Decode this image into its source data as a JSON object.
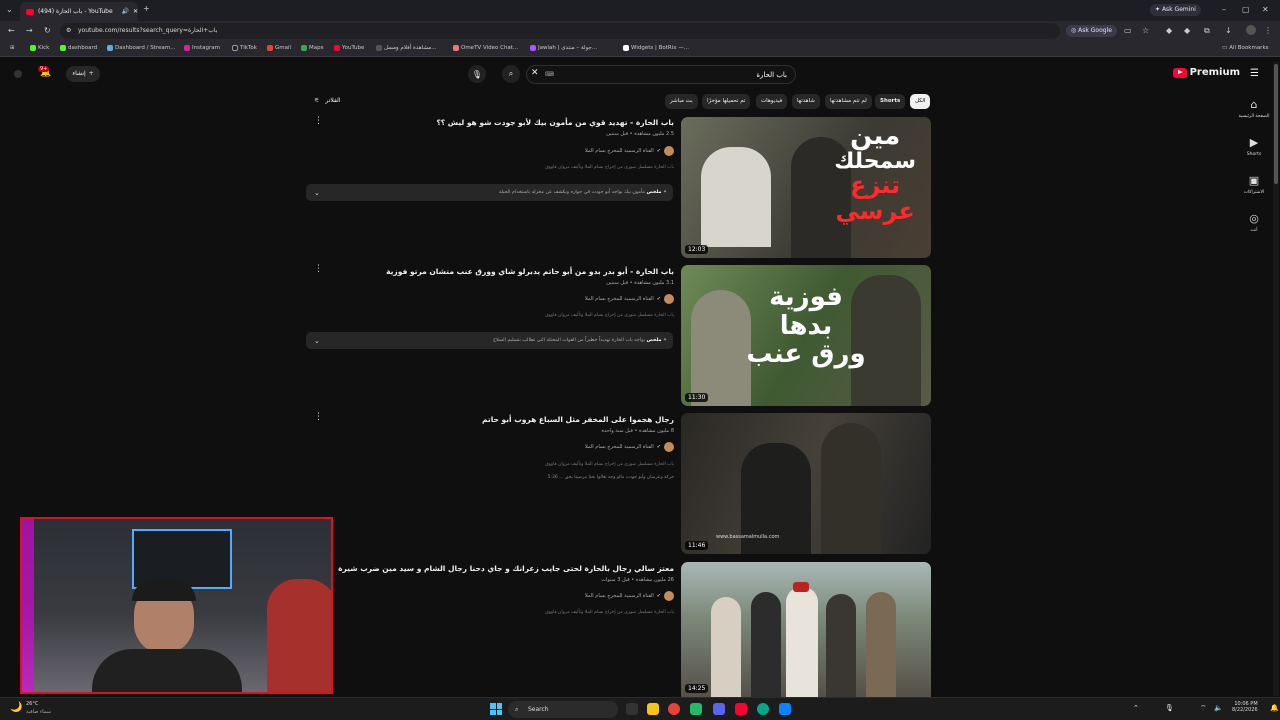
{
  "browser": {
    "tab_title": "(494) باب الحارة - YouTube",
    "url": "youtube.com/results?search_query=باب+الحارة",
    "ask_google": "Ask Google",
    "ask_gemini": "Ask Gemini",
    "all_bookmarks": "All Bookmarks",
    "bookmarks": [
      "Kick",
      "dashboard",
      "Dashboard / Stream...",
      "Instagram",
      "TikTok",
      "Gmail",
      "Maps",
      "YouTube",
      "مشاهدة أفلام ومسل...",
      "OmeTV Video Chat...",
      "Jawlah | جولة – منتدى...",
      "Widgets | BotRix —..."
    ]
  },
  "youtube": {
    "logo_text": "Premium",
    "search_value": "باب الحارة",
    "create_label": "إنشاء",
    "notif_count": "9+",
    "filters_label": "الفلاتر",
    "chips": [
      "الكل",
      "Shorts",
      "لم تتم مشاهدتها",
      "شاهدتها",
      "فيديوهات",
      "تم تحميلها مؤخرًا",
      "بث مباشر"
    ],
    "sidebar": [
      {
        "label": "الصفحة الرئيسية",
        "icon": "home-icon"
      },
      {
        "label": "Shorts",
        "icon": "shorts-icon"
      },
      {
        "label": "الاشتراكات",
        "icon": "subscriptions-icon"
      },
      {
        "label": "أنت",
        "icon": "you-icon"
      }
    ],
    "results": [
      {
        "title": "باب الحارة - تهديد قوي من مأمون بيك لأبو جودت شو هو ليش ؟؟",
        "meta": "2.5 مليون مشاهدة • قبل سنتين",
        "channel": "القناة الرسمية للمخرج بسام الملا",
        "desc": "باب الحارة مسلسل سوري من إخراج بسام الملا وتأليف مروان قاووق",
        "summary_label": "ملخص",
        "summary": "مأمون بيك يواجه أبو جودت في حواره ويكشف عن مخزله باستخدام الحيلة",
        "duration": "12:03",
        "thumb_text": [
          "مين",
          "سمحلك",
          "تنزع",
          "عرسي"
        ]
      },
      {
        "title": "باب الحارة - أبو بدر بدو من أبو حاتم يدبرلو شاي وورق عنب متشان مرتو فوزية",
        "meta": "3.1 مليون مشاهدة • قبل سنتين",
        "channel": "القناة الرسمية للمخرج بسام الملا",
        "desc": "باب الحارة مسلسل سوري من إخراج بسام الملا وتأليف مروان قاووق",
        "summary_label": "ملخص",
        "summary": "يواجه باب الحارة تهديداً خطيراً من القوات المحتلة التي تطالب بتسليم السلاح",
        "duration": "11:30",
        "thumb_text": [
          "فوزية",
          "بدها",
          "ورق عنب"
        ]
      },
      {
        "title": "رجال هجموا على المخفر مثل السباع هروب أبو حاتم",
        "meta": "8 مليون مشاهدة • قبل سنة واحدة",
        "channel": "القناة الرسمية للمخرج بسام الملا",
        "desc": "باب الحارة مسلسل سوري من إخراج بسام الملا وتأليف مروان قاووق",
        "desc2": "حركة وعرضان وأبو جودت مالو وجه تعالوا نحنا مرضينا بحق ... 5:36",
        "duration": "11:46",
        "watermark": "www.bassamalmulla.com"
      },
      {
        "title": "معتز سالي رجال بالحارة لحتى جايب زعرانك و جاي دحنا رجال الشام و سيد مين ضرب شيرة",
        "meta": "26 مليون مشاهدة • قبل 3 سنوات",
        "channel": "القناة الرسمية للمخرج بسام الملا",
        "desc": "باب الحارة مسلسل سوري من إخراج بسام الملا وتأليف مروان قاووق",
        "duration": "14:25"
      }
    ]
  },
  "taskbar": {
    "weather_temp": "26°C",
    "weather_desc": "سماء صافية",
    "search_label": "Search",
    "time": "10:06 PM",
    "date": "8/22/2026"
  },
  "colors": {
    "yt_red": "#ff0033",
    "bg": "#0f0f0f",
    "chip": "#272727"
  }
}
